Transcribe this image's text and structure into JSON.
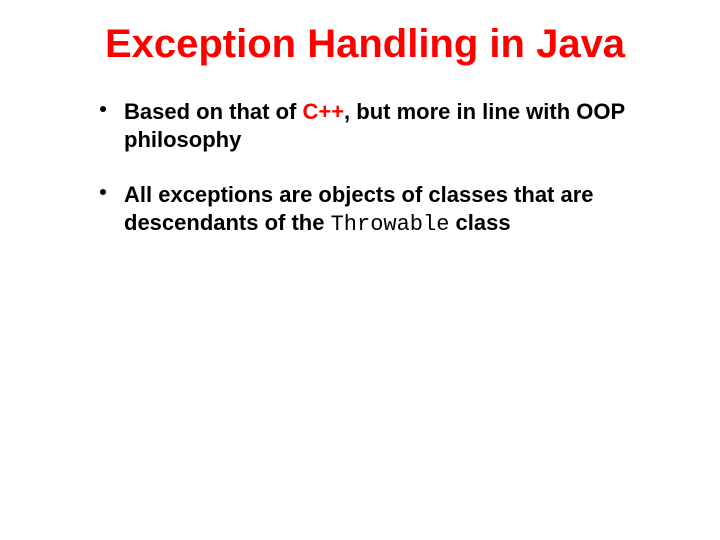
{
  "title": "Exception Handling in Java",
  "bullets": [
    {
      "prefix": "Based on that of ",
      "highlight": "C++",
      "suffix": ", but more in line with OOP philosophy"
    },
    {
      "prefix": "All exceptions are objects of classes that are descendants of the ",
      "code": "Throwable",
      "suffix": " class"
    }
  ]
}
